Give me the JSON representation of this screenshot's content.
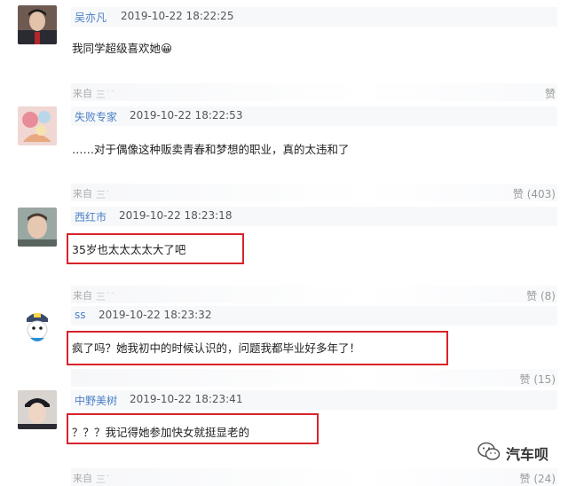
{
  "comments": [
    {
      "name": "吴亦凡",
      "time": "2019-10-22 18:22:25",
      "text": "我同学超级喜欢她😀",
      "source": "来自",
      "source_client": "三  ̇ ̇",
      "likes": "赞"
    },
    {
      "name": "失败专家",
      "time": "2019-10-22 18:22:53",
      "text": "……对于偶像这种贩卖青春和梦想的职业，真的太违和了",
      "source": "来自",
      "source_client": "三  ̇",
      "likes": "赞 (403)"
    },
    {
      "name": "西红市",
      "time": "2019-10-22 18:23:18",
      "text": "35岁也太太太太大了吧",
      "source": "来自",
      "source_client": "三  ̇ ̇",
      "likes": "赞 (8)"
    },
    {
      "name": "ss",
      "time": "2019-10-22 18:23:32",
      "text": "疯了吗？她我初中的时候认识的，问题我都毕业好多年了！",
      "source": "",
      "source_client": "",
      "likes": "赞 (15)"
    },
    {
      "name": "中野美树",
      "time": "2019-10-22 18:23:41",
      "text": "？？？我记得她参加快女就挺显老的",
      "source": "来自",
      "source_client": "三  ̇",
      "likes": "赞 (24)"
    }
  ],
  "watermark": {
    "text": "汽车呗",
    "icon": "wechat-logo-icon"
  },
  "colors": {
    "name": "#4b7fc4",
    "highlight": "#d8232a",
    "meta_bg": "#f7f8fa"
  }
}
